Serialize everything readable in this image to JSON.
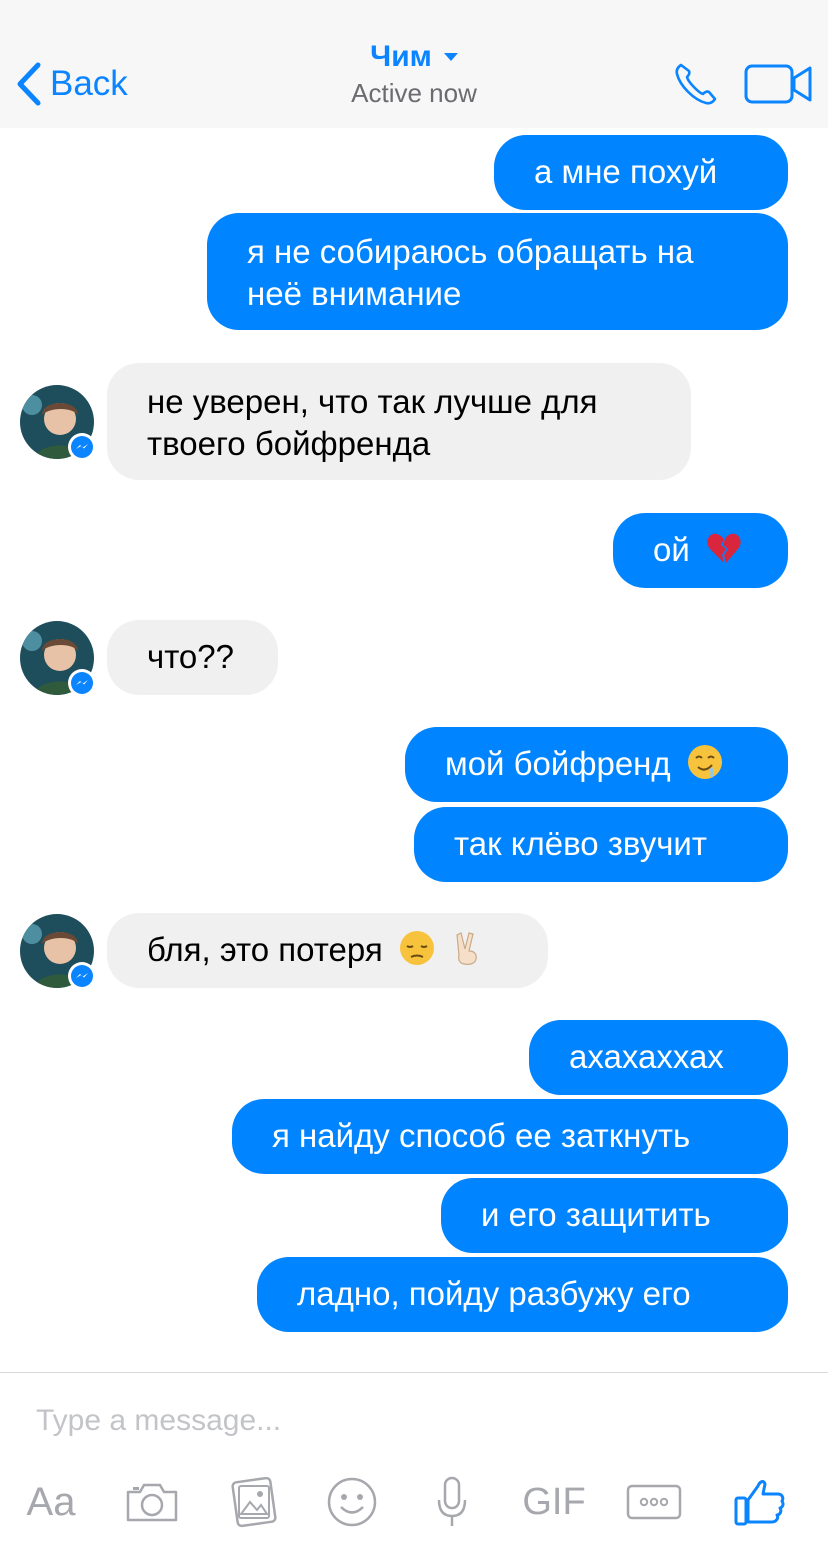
{
  "header": {
    "back_label": "Back",
    "contact_name": "Чим",
    "status": "Active now",
    "accent_color": "#0a84ff"
  },
  "messages": [
    {
      "side": "out",
      "text": "а мне похуй"
    },
    {
      "side": "out",
      "line1": "я не собираюсь обращать на",
      "line2": "неё внимание"
    },
    {
      "side": "in",
      "line1": "не уверен, что так лучше для",
      "line2": "твоего бойфренда"
    },
    {
      "side": "out",
      "text": "ой",
      "emoji": "broken-heart-icon"
    },
    {
      "side": "in",
      "text": "что??"
    },
    {
      "side": "out",
      "text": "мой бойфренд",
      "emoji": "drooling-face-icon"
    },
    {
      "side": "out",
      "text": "так клёво звучит"
    },
    {
      "side": "in",
      "text": "бля, это потеря",
      "emoji": "pensive-face-icon, victory-hand-icon"
    },
    {
      "side": "out",
      "text": "ахахаххах"
    },
    {
      "side": "out",
      "text": "я найду способ ее заткнуть"
    },
    {
      "side": "out",
      "text": "и его защитить"
    },
    {
      "side": "out",
      "text": "ладно, пойду разбужу его"
    }
  ],
  "composer": {
    "placeholder": "Type a message...",
    "aa_label": "Aa",
    "gif_label": "GIF",
    "icons": [
      "camera-icon",
      "gallery-icon",
      "emoji-icon",
      "microphone-icon",
      "more-icon",
      "like-thumb-icon"
    ]
  },
  "colors": {
    "outgoing_bubble": "#0084ff",
    "incoming_bubble": "#f1f0f0",
    "icon_gray": "#a7a8ad"
  }
}
